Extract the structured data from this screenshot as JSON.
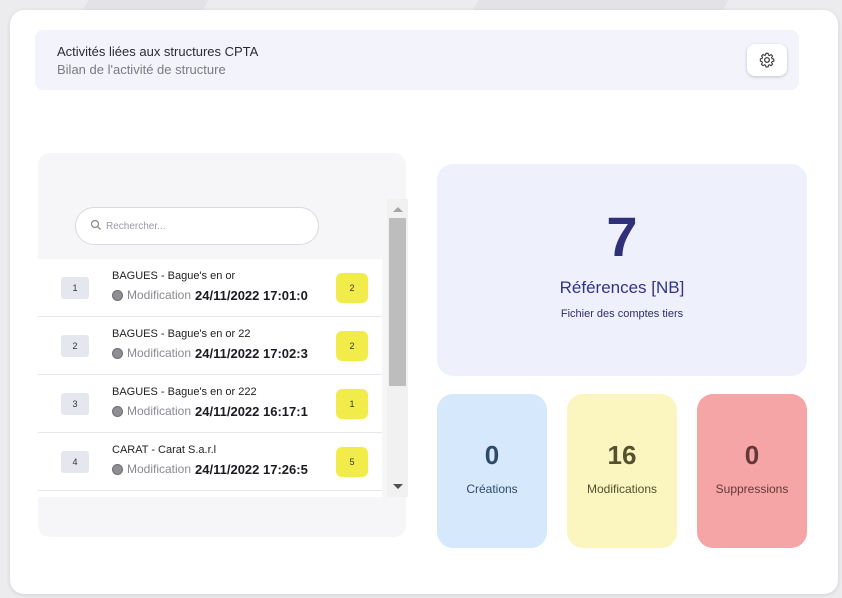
{
  "header": {
    "title": "Activités liées aux structures CPTA",
    "subtitle": "Bilan de l'activité de structure",
    "settings_icon": "gear-icon"
  },
  "search": {
    "placeholder": "Rechercher...",
    "value": "",
    "icon": "search-icon"
  },
  "list": {
    "items": [
      {
        "num": "1",
        "title": "BAGUES - Bague's en or",
        "action": "Modification",
        "date": "24/11/2022 17:01:0",
        "count": "2"
      },
      {
        "num": "2",
        "title": "BAGUES - Bague's en or 22",
        "action": "Modification",
        "date": "24/11/2022 17:02:3",
        "count": "2"
      },
      {
        "num": "3",
        "title": "BAGUES - Bague's en or 222",
        "action": "Modification",
        "date": "24/11/2022 16:17:1",
        "count": "1"
      },
      {
        "num": "4",
        "title": "CARAT - Carat S.a.r.l",
        "action": "Modification",
        "date": "24/11/2022 17:26:5",
        "count": "5"
      }
    ]
  },
  "stats": {
    "references": {
      "value": "7",
      "label": "Références [NB]",
      "sublabel": "Fichier des comptes tiers"
    },
    "creations": {
      "value": "0",
      "label": "Créations"
    },
    "modifications": {
      "value": "16",
      "label": "Modifications"
    },
    "suppressions": {
      "value": "0",
      "label": "Suppressions"
    }
  },
  "colors": {
    "creations": "#d6e8fc",
    "modifications": "#fbf6c0",
    "suppressions": "#f5a5a6",
    "references": "#eef0fc",
    "count_badge": "#f2ec4a"
  }
}
